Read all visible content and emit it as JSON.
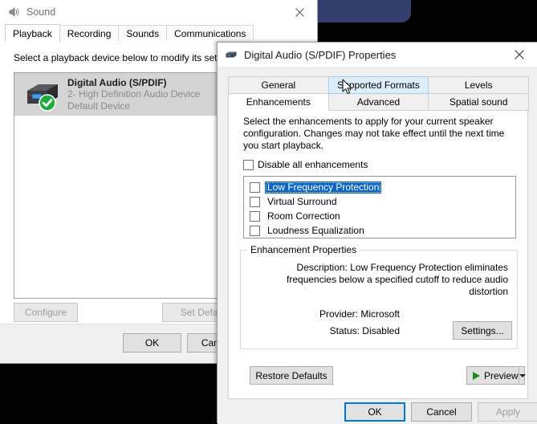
{
  "sound_window": {
    "title": "Sound",
    "icon": "speaker-icon",
    "close_label": "✕",
    "tabs": [
      {
        "label": "Playback",
        "active": true
      },
      {
        "label": "Recording",
        "active": false
      },
      {
        "label": "Sounds",
        "active": false
      },
      {
        "label": "Communications",
        "active": false
      }
    ],
    "instruction": "Select a playback device below to modify its settings:",
    "devices": [
      {
        "name": "Digital Audio (S/PDIF)",
        "subtitle1": "2- High Definition Audio Device",
        "subtitle2": "Default Device",
        "icon": "spdif-device-icon",
        "badge": "default-device-check-icon",
        "selected": true
      }
    ],
    "buttons": {
      "configure": "Configure",
      "set_default": "Set Default",
      "ok": "OK",
      "cancel": "Cancel"
    }
  },
  "properties_window": {
    "title": "Digital Audio (S/PDIF) Properties",
    "icon": "spdif-device-icon",
    "close_label": "✕",
    "tabs_row1": [
      {
        "label": "General",
        "state": "normal"
      },
      {
        "label": "Supported Formats",
        "state": "hover"
      },
      {
        "label": "Levels",
        "state": "normal"
      }
    ],
    "tabs_row2": [
      {
        "label": "Enhancements",
        "state": "active"
      },
      {
        "label": "Advanced",
        "state": "normal"
      },
      {
        "label": "Spatial sound",
        "state": "normal"
      }
    ],
    "page": {
      "description": "Select the enhancements to apply for your current speaker configuration. Changes may not take effect until the next time you start playback.",
      "disable_all_label": "Disable all enhancements",
      "disable_all_checked": false,
      "enhancements": [
        {
          "label": "Low Frequency Protection",
          "checked": false,
          "selected": true
        },
        {
          "label": "Virtual Surround",
          "checked": false,
          "selected": false
        },
        {
          "label": "Room Correction",
          "checked": false,
          "selected": false
        },
        {
          "label": "Loudness Equalization",
          "checked": false,
          "selected": false
        }
      ],
      "group": {
        "title": "Enhancement Properties",
        "description": "Description: Low Frequency Protection eliminates frequencies below a specified cutoff to reduce audio distortion",
        "provider": "Provider: Microsoft",
        "status": "Status: Disabled",
        "settings_button": "Settings..."
      },
      "restore_defaults": "Restore Defaults",
      "preview": "Preview",
      "preview_dropdown_icon": "chevron-down-icon"
    },
    "buttons": {
      "ok": "OK",
      "cancel": "Cancel",
      "apply": "Apply"
    }
  },
  "colors": {
    "accent_blue": "#0078d7",
    "selection_blue": "#0a64c8",
    "tab_hover_blue": "#ddeefb",
    "desktop_shape": "#343f6e",
    "check_green": "#1faa3c",
    "play_green": "#1a8b1a"
  }
}
